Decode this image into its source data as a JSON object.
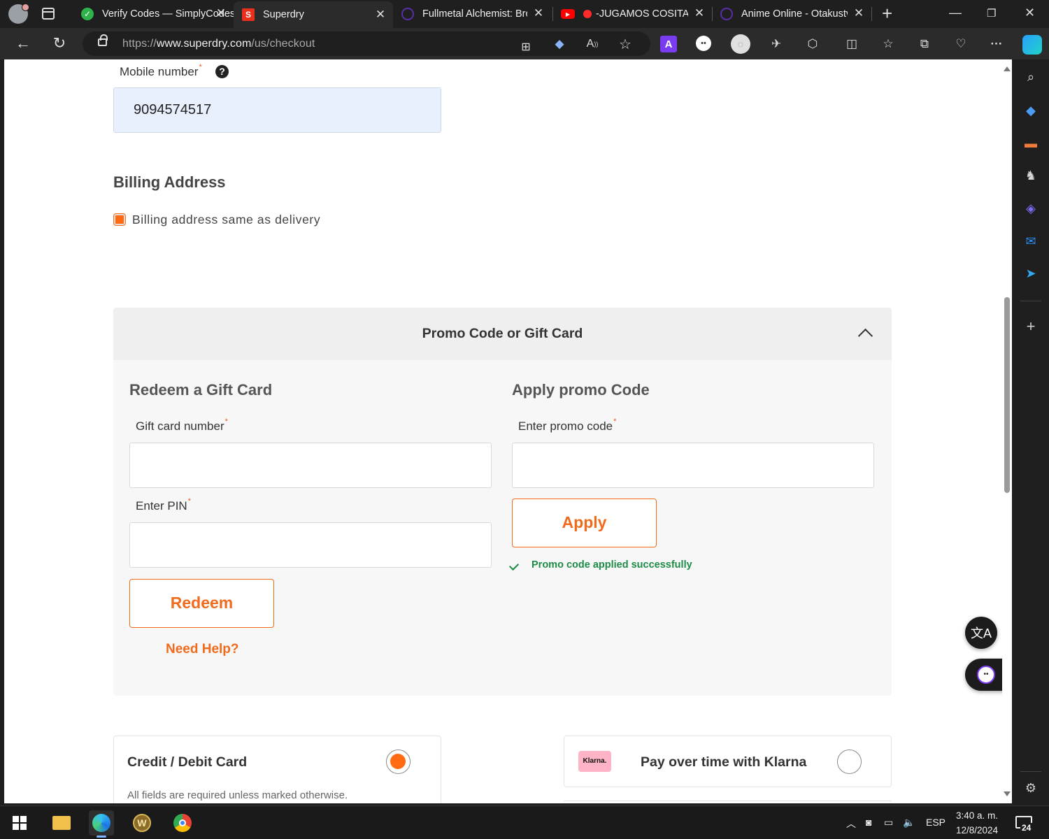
{
  "browser": {
    "tabs": [
      {
        "title": "Verify Codes — SimplyCodes",
        "favicon": "simplycodes-icon",
        "color": "#2db34a"
      },
      {
        "title": "Superdry",
        "favicon": "superdry-icon",
        "color": "#e8301c",
        "active": true
      },
      {
        "title": "Fullmetal Alchemist: Brotherhood",
        "favicon": "anime-icon",
        "color": "#5a2ea6"
      },
      {
        "title": "-JUGAMOS COSITAS",
        "favicon": "youtube-icon",
        "color": "#ff0000"
      },
      {
        "title": "Anime Online - Otakustv",
        "favicon": "otakustv-icon",
        "color": "#5a2ea6"
      }
    ],
    "url_prefix": "https://",
    "url_domain": "www.superdry.com",
    "url_path": "/us/checkout",
    "superdry_favicon_letter": "S",
    "ext_letter_a": "A"
  },
  "page": {
    "mobile_label": "Mobile number",
    "required_mark": "*",
    "help_mark": "?",
    "mobile_value": "9094574517",
    "billing_heading": "Billing Address",
    "billing_same_label": "Billing address same as delivery",
    "promo_title": "Promo Code or Gift Card",
    "gift_heading": "Redeem a Gift Card",
    "gift_card_label": "Gift card number",
    "pin_label": "Enter PIN",
    "redeem_label": "Redeem",
    "need_help_label": "Need Help?",
    "promo_heading": "Apply promo Code",
    "promo_label": "Enter promo code",
    "apply_label": "Apply",
    "promo_success": "Promo code applied successfully",
    "card_title": "Credit / Debit Card",
    "card_note": "All fields are required unless marked otherwise.",
    "klarna_badge": "Klarna.",
    "klarna_title": "Pay over time with Klarna"
  },
  "taskbar": {
    "language": "ESP",
    "time": "3:40 a. m.",
    "date": "12/8/2024",
    "notif_count": "24"
  },
  "colors": {
    "accent": "#f06b1c",
    "success": "#1d8c47",
    "autofill": "#e8f0fe"
  }
}
